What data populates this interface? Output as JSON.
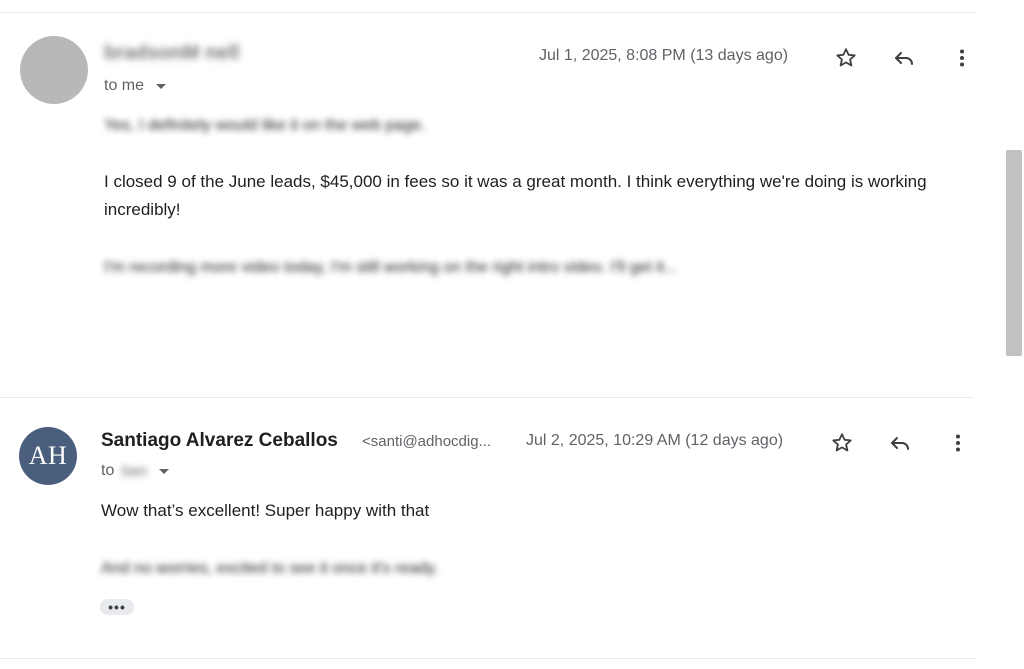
{
  "messages": [
    {
      "sender_name": "bradsonM nell",
      "to_label": "to me",
      "date": "Jul 1, 2025, 8:08 PM (13 days ago)",
      "paragraphs": [
        "Yes, I definitely would like it on the web page.",
        "I closed 9 of the June leads, $45,000 in fees so it was a great month. I think everything we're doing is working incredibly!",
        "I'm recording more video today, I'm still working on the right intro video. I'll get it..."
      ]
    },
    {
      "avatar_initials": "AH",
      "sender_name": "Santiago Alvarez Ceballos",
      "sender_email": "<santi@adhocdig...",
      "to_label": "to",
      "to_name": "Sen",
      "date": "Jul 2, 2025, 10:29 AM (12 days ago)",
      "paragraphs": [
        "Wow that’s excellent! Super happy with that",
        "And no worries, excited to see it once it's ready."
      ],
      "trimmed_content_label": "•••"
    }
  ],
  "icons": {
    "star": "star-icon",
    "reply": "reply-icon",
    "more": "more-vert-icon",
    "dropdown": "caret-down-icon"
  },
  "colors": {
    "avatar_ah": "#4a5f7e",
    "avatar_gray": "#b8b8b8",
    "divider": "#e8eaed"
  }
}
